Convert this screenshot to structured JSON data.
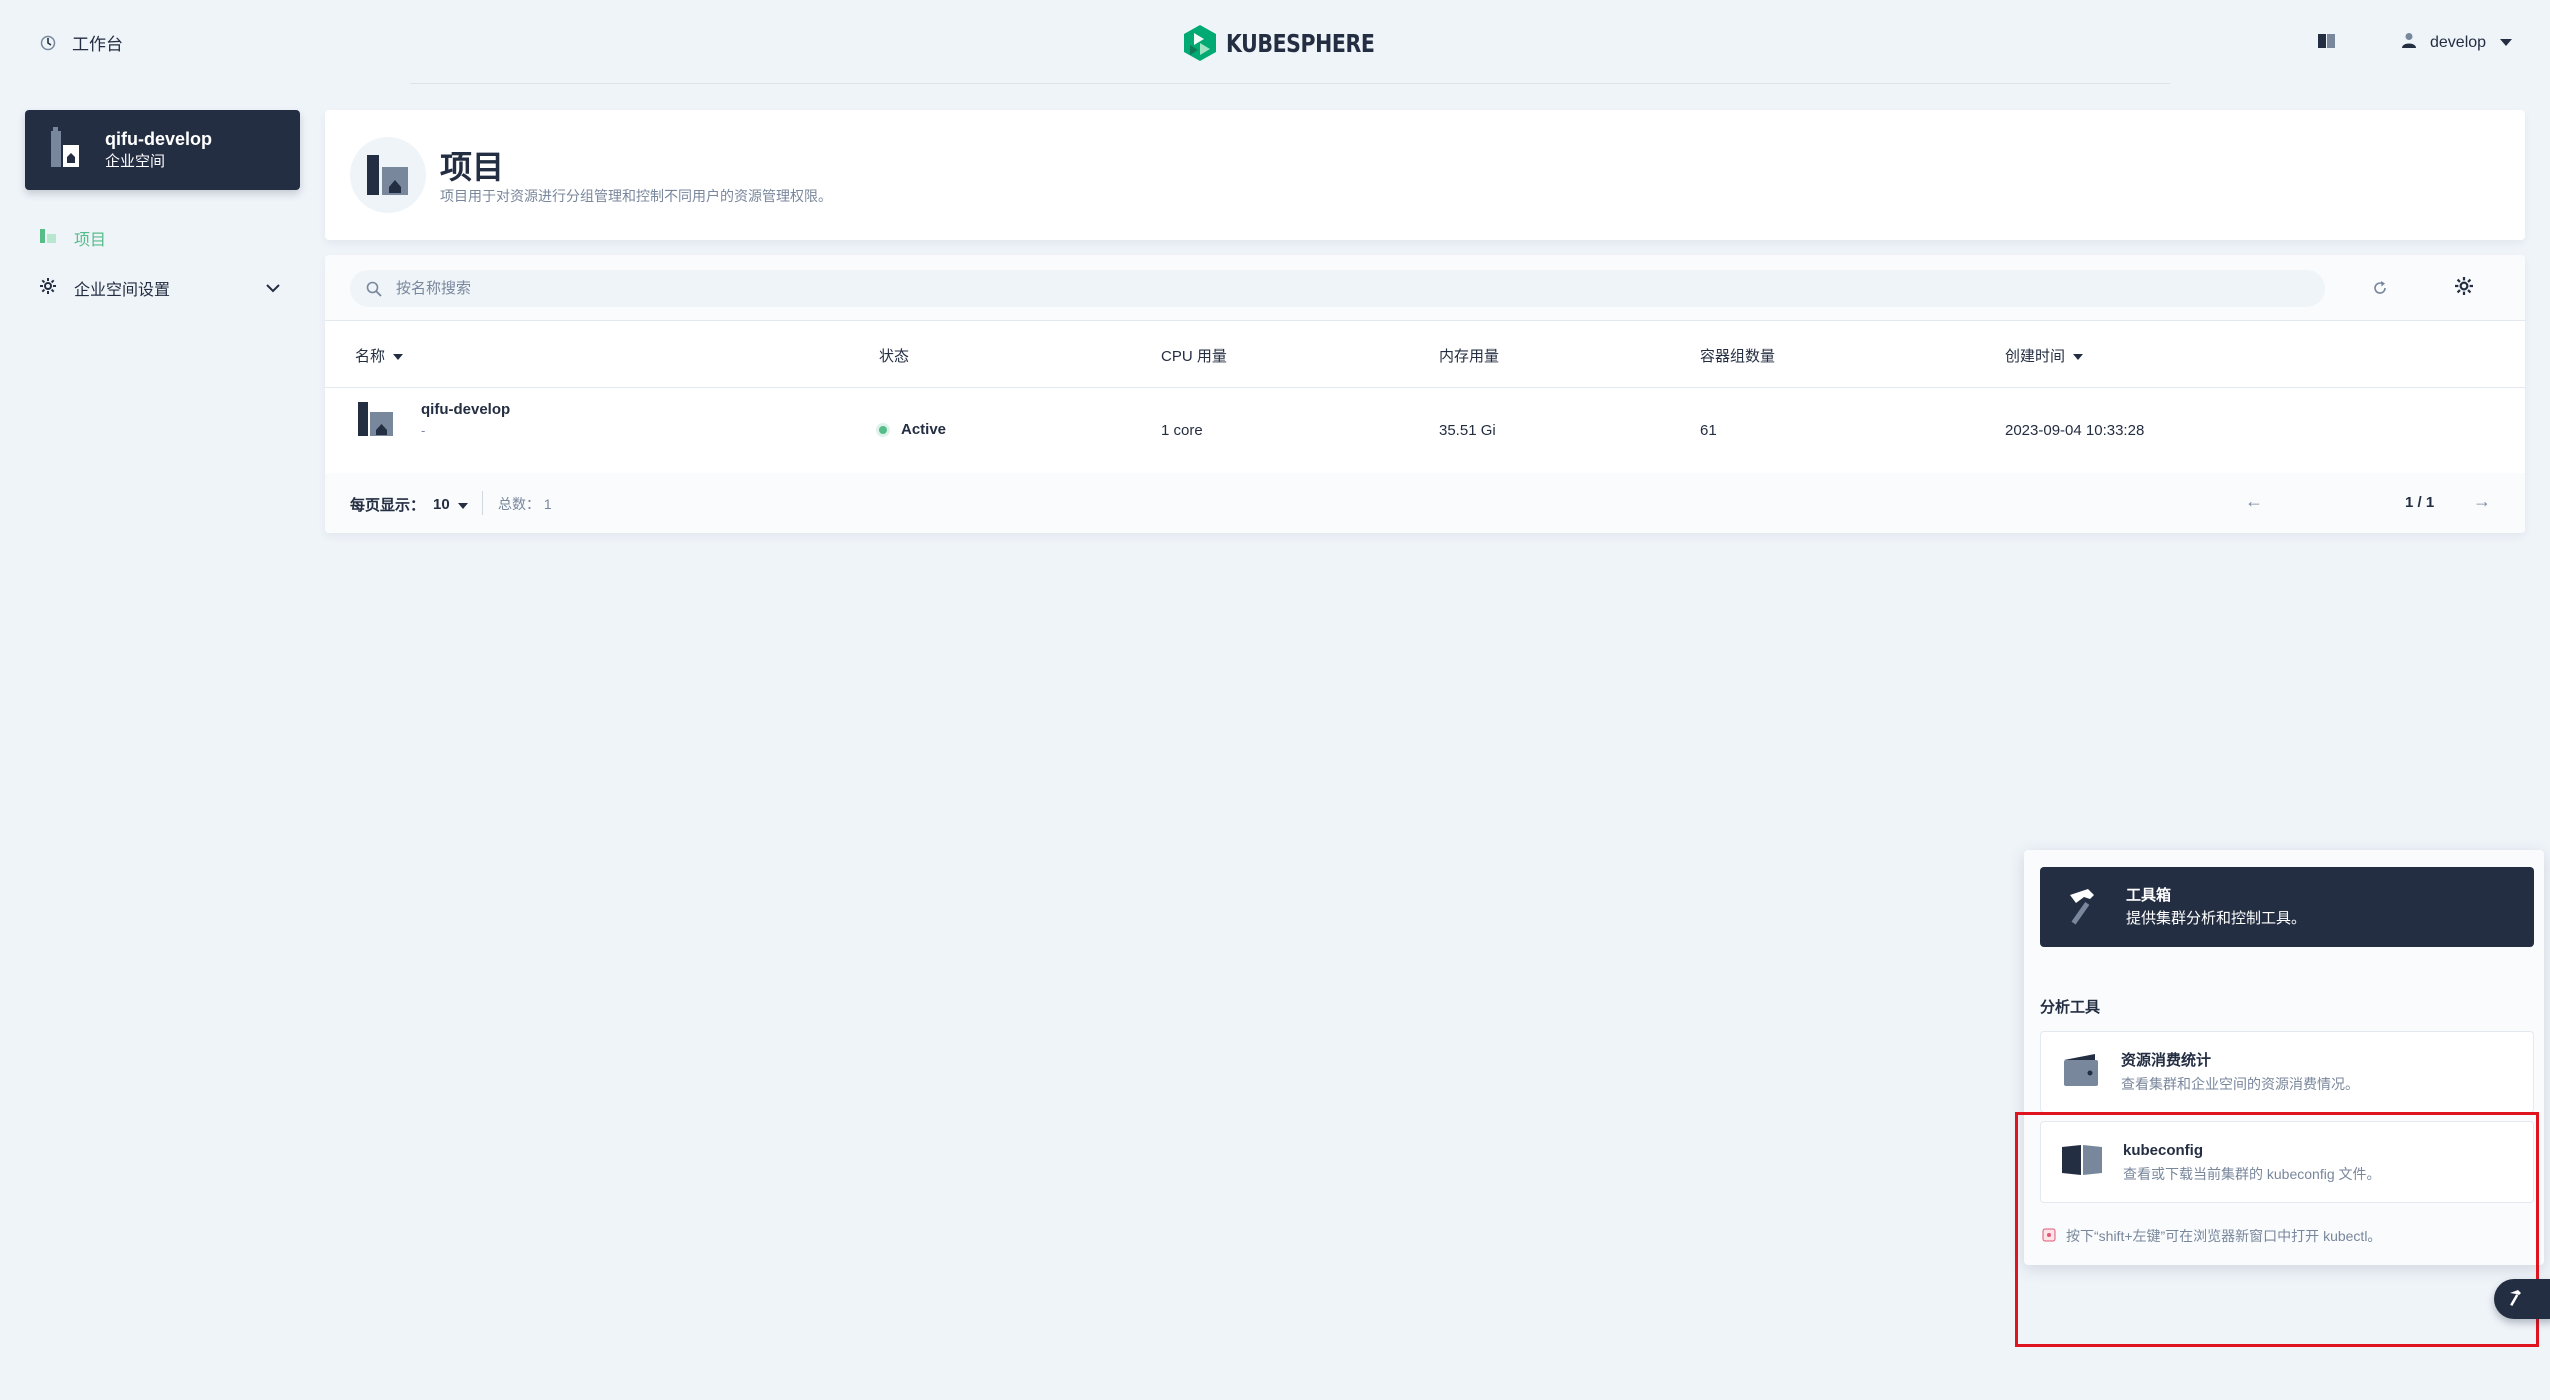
{
  "header": {
    "workbench_label": "工作台",
    "brand": "KUBESPHERE",
    "user_name": "develop"
  },
  "sidebar": {
    "workspace_name": "qifu-develop",
    "workspace_type": "企业空间",
    "items": [
      {
        "label": "项目",
        "icon": "project-icon",
        "active": true
      },
      {
        "label": "企业空间设置",
        "icon": "gear-icon",
        "expandable": true
      }
    ]
  },
  "banner": {
    "title": "项目",
    "description": "项目用于对资源进行分组管理和控制不同用户的资源管理权限。"
  },
  "table": {
    "search_placeholder": "按名称搜索",
    "columns": [
      "名称",
      "状态",
      "CPU 用量",
      "内存用量",
      "容器组数量",
      "创建时间"
    ],
    "rows": [
      {
        "name": "qifu-develop",
        "desc": "-",
        "status": "Active",
        "cpu": "1 core",
        "memory": "35.51 Gi",
        "pods": "61",
        "created": "2023-09-04 10:33:28"
      }
    ],
    "footer": {
      "per_page_label": "每页显示：",
      "per_page_value": "10",
      "total": "总数：  1",
      "page": "1 / 1"
    }
  },
  "toolbox": {
    "title": "工具箱",
    "subtitle": "提供集群分析和控制工具。",
    "section": "分析工具",
    "items": [
      {
        "title": "资源消费统计",
        "desc": "查看集群和企业空间的资源消费情况。",
        "icon": "wallet-icon"
      },
      {
        "title": "kubeconfig",
        "desc": "查看或下载当前集群的 kubeconfig 文件。",
        "icon": "book-icon"
      }
    ],
    "tip": "按下“shift+左键”可在浏览器新窗口中打开 kubectl。"
  },
  "colors": {
    "primary_dark": "#242e42",
    "accent_green": "#55bc8a",
    "background": "#eff4f9",
    "highlight_red": "#e0141e"
  }
}
